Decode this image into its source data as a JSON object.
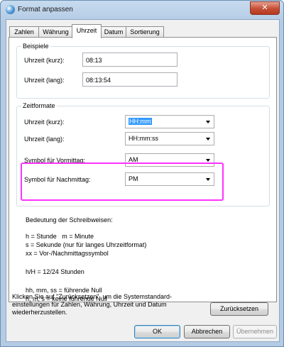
{
  "window": {
    "title": "Format anpassen",
    "close_glyph": "✕"
  },
  "tabs": [
    {
      "label": "Zahlen"
    },
    {
      "label": "Währung"
    },
    {
      "label": "Uhrzeit"
    },
    {
      "label": "Datum"
    },
    {
      "label": "Sortierung"
    }
  ],
  "active_tab": "Uhrzeit",
  "beispiele": {
    "title": "Beispiele",
    "short_label": "Uhrzeit (kurz):",
    "short_value": "08:13",
    "long_label": "Uhrzeit (lang):",
    "long_value": "08:13:54"
  },
  "zeitformate": {
    "title": "Zeitformate",
    "short_label": "Uhrzeit (kurz):",
    "short_value": "HH:mm",
    "long_label": "Uhrzeit (lang):",
    "long_value": "HH:mm:ss",
    "am_label": "Symbol für Vormittag:",
    "am_value": "AM",
    "pm_label": "Symbol für Nachmittag:",
    "pm_value": "PM"
  },
  "notation": {
    "heading": "Bedeutung der Schreibweisen:",
    "line1": "h = Stunde   m = Minute",
    "line2": "s = Sekunde (nur für langes Uhrzeitformat)",
    "line3": "xx = Vor-/Nachmittagssymbol",
    "line4": "h/H = 12/24 Stunden",
    "line5": "hh, mm, ss = führende Null",
    "line6": "h, m, s = keine führende Null"
  },
  "reset": {
    "text": "Klicken Sie auf \"Zurücksetzen\", um die Systemstandard-\neinstellungen für Zahlen, Währung, Uhrzeit und Datum\nwiederherzustellen.",
    "button": "Zurücksetzen"
  },
  "buttons": {
    "ok": "OK",
    "cancel": "Abbrechen",
    "apply": "Übernehmen"
  },
  "colors": {
    "highlight": "#ff33ff",
    "selection": "#3399ff"
  }
}
